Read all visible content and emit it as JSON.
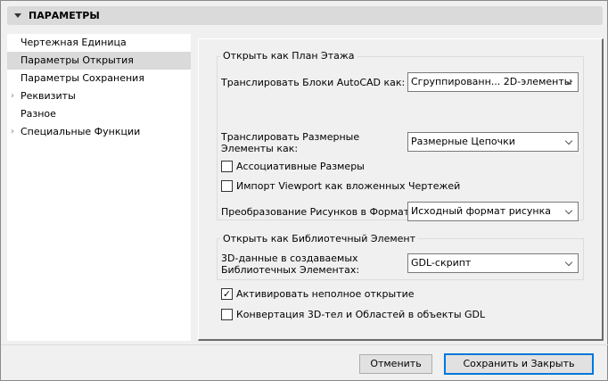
{
  "header": {
    "title": "ПАРАМЕТРЫ"
  },
  "sidebar": {
    "items": [
      {
        "label": "Чертежная Единица",
        "expandable": false,
        "selected": false
      },
      {
        "label": "Параметры Открытия",
        "expandable": false,
        "selected": true
      },
      {
        "label": "Параметры Сохранения",
        "expandable": false,
        "selected": false
      },
      {
        "label": "Реквизиты",
        "expandable": true,
        "selected": false
      },
      {
        "label": "Разное",
        "expandable": false,
        "selected": false
      },
      {
        "label": "Специальные Функции",
        "expandable": true,
        "selected": false
      }
    ]
  },
  "floor_plan": {
    "title": "Открыть как План Этажа",
    "blocks_label": "Транслировать Блоки AutoCAD как:",
    "blocks_value": "Сгруппированн... 2D-элементы",
    "dims_label": "Транслировать Размерные Элементы как:",
    "dims_value": "Размерные Цепочки",
    "assoc_label": "Ассоциативные Размеры",
    "assoc_checked": false,
    "viewport_label": "Импорт Viewport как вложенных Чертежей",
    "viewport_checked": false,
    "images_label": "Преобразование Рисунков в Формат:",
    "images_value": "Исходный формат рисунка"
  },
  "library": {
    "title": "Открыть как Библиотечный Элемент",
    "data3d_label": "3D-данные в создаваемых Библиотечных Элементах:",
    "data3d_value": "GDL-скрипт"
  },
  "partial_label": "Активировать неполное открытие",
  "partial_checked": true,
  "partial_mark": "✓",
  "convert_label": "Конвертация 3D-тел и Областей в объекты GDL",
  "convert_checked": false,
  "buttons": {
    "cancel": "Отменить",
    "save": "Сохранить и Закрыть"
  },
  "colors": {
    "focus": "#0078d7"
  }
}
